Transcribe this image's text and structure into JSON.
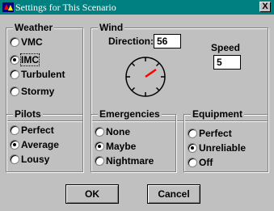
{
  "window": {
    "title": "Settings for This Scenario",
    "close_glyph": "X",
    "title_bar_color": "#008080",
    "background_color": "#c0c0c0"
  },
  "weather": {
    "legend": "Weather",
    "options": [
      "VMC",
      "IMC",
      "Turbulent",
      "Stormy"
    ],
    "selected": "IMC"
  },
  "wind": {
    "legend": "Wind",
    "direction_label": "Direction:",
    "direction_value": "56",
    "speed_label": "Speed",
    "speed_value": "5",
    "needle_color": "#ff0000"
  },
  "pilots": {
    "legend": "Pilots",
    "options": [
      "Perfect",
      "Average",
      "Lousy"
    ],
    "selected": "Average"
  },
  "emergencies": {
    "legend": "Emergencies",
    "options": [
      "None",
      "Maybe",
      "Nightmare"
    ],
    "selected": "Maybe"
  },
  "equipment": {
    "legend": "Equipment",
    "options": [
      "Perfect",
      "Unreliable",
      "Off"
    ],
    "selected": "Unreliable"
  },
  "buttons": {
    "ok_label": "OK",
    "cancel_label": "Cancel"
  }
}
